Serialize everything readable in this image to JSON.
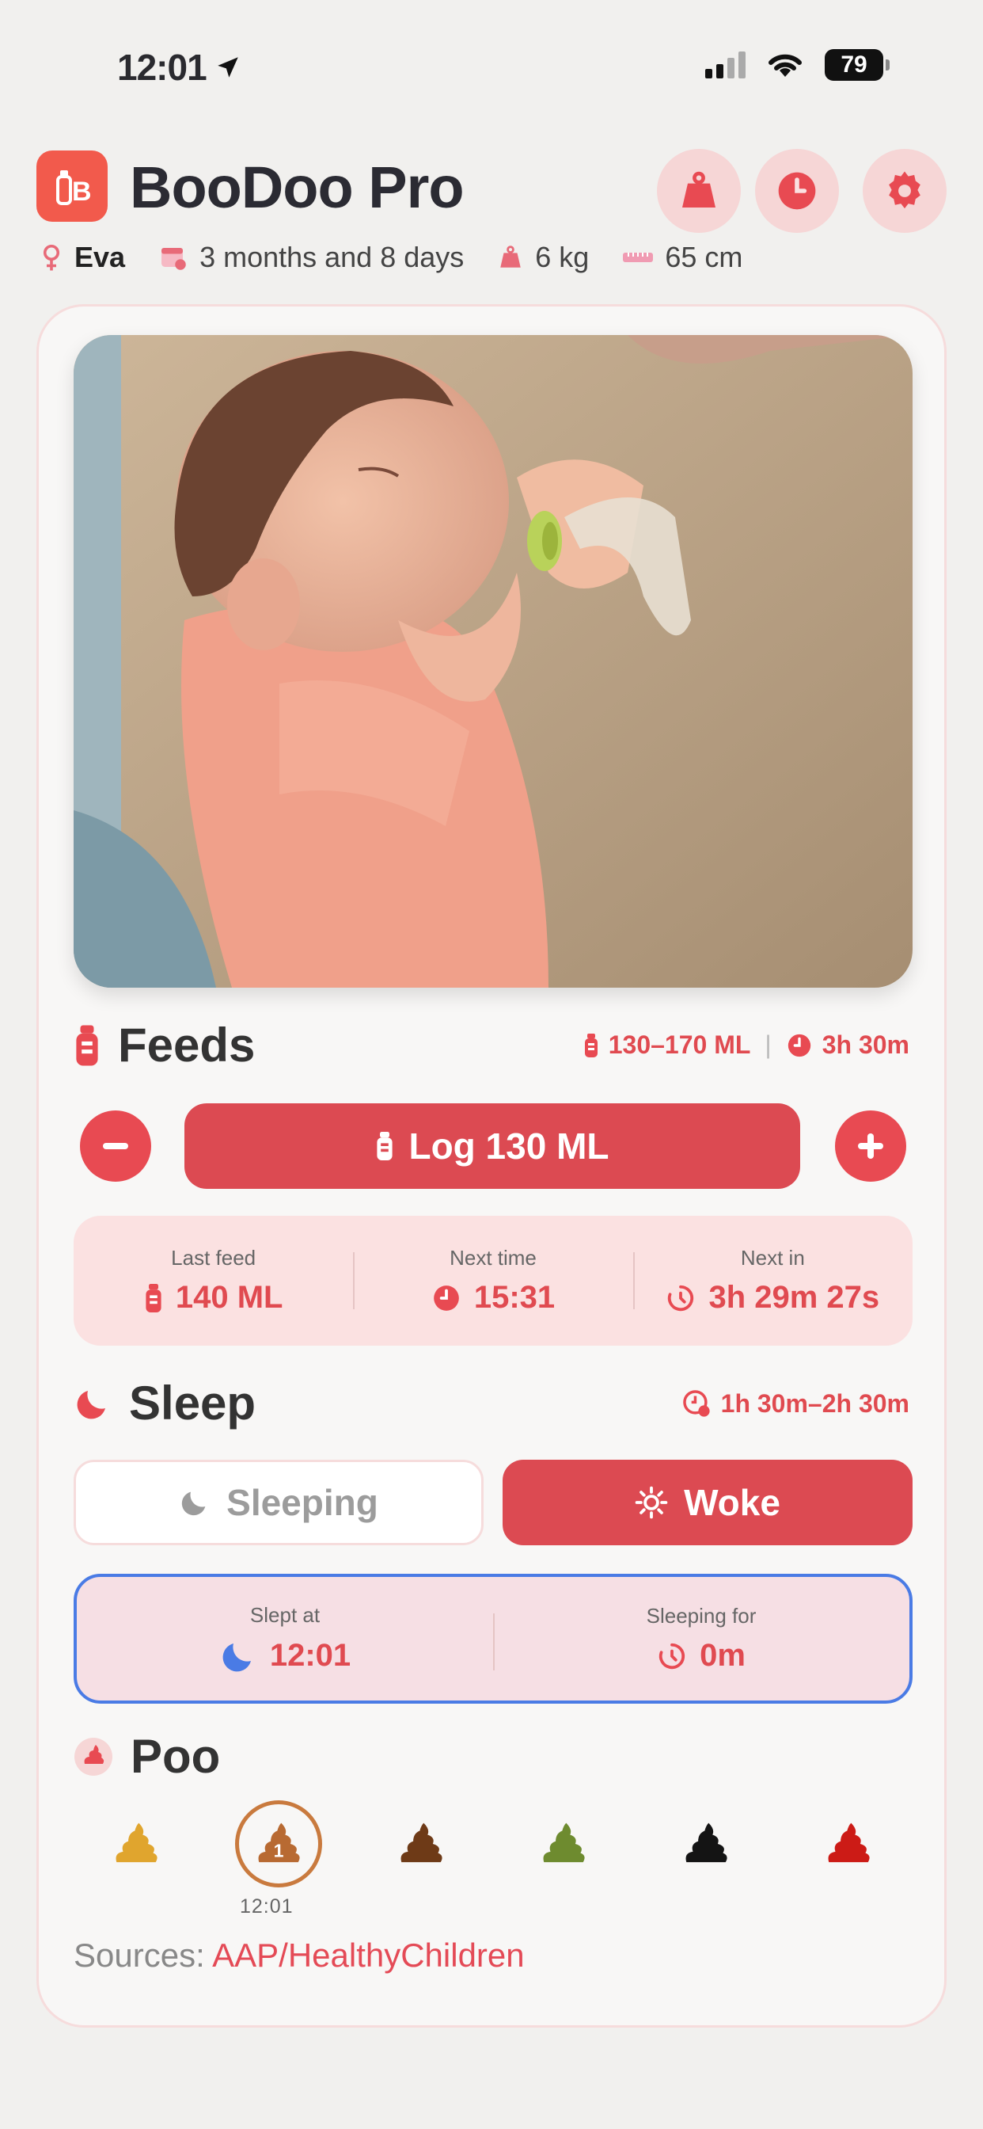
{
  "status_bar": {
    "time": "12:01",
    "battery": "79"
  },
  "header": {
    "app_title": "BooDoo Pro",
    "buttons": [
      "weight-icon",
      "clock-icon",
      "gear-icon"
    ]
  },
  "baby": {
    "name": "Eva",
    "age": "3 months and 8 days",
    "weight": "6 kg",
    "height": "65 cm"
  },
  "feeds": {
    "title": "Feeds",
    "range": "130–170 ML",
    "separator": "|",
    "interval": "3h 30m",
    "log_button": "Log 130 ML",
    "last_feed_label": "Last feed",
    "last_feed_value": "140 ML",
    "next_time_label": "Next time",
    "next_time_value": "15:31",
    "next_in_label": "Next in",
    "next_in_value": "3h 29m 27s"
  },
  "sleep": {
    "title": "Sleep",
    "range": "1h 30m–2h 30m",
    "sleeping_label": "Sleeping",
    "woke_label": "Woke",
    "slept_at_label": "Slept at",
    "slept_at_value": "12:01",
    "sleeping_for_label": "Sleeping for",
    "sleeping_for_value": "0m"
  },
  "poo": {
    "title": "Poo",
    "colors": [
      "#e0a52e",
      "#b86a32",
      "#6e3a17",
      "#6e8b2f",
      "#141414",
      "#cc1b16"
    ],
    "selected_badge": "1",
    "selected_time": "12:01"
  },
  "sources": {
    "label": "Sources:",
    "link": "AAP/HealthyChildren"
  },
  "colors": {
    "accent": "#dc4a52",
    "accent_light": "#fbe1e1",
    "blue": "#4a7be5"
  }
}
